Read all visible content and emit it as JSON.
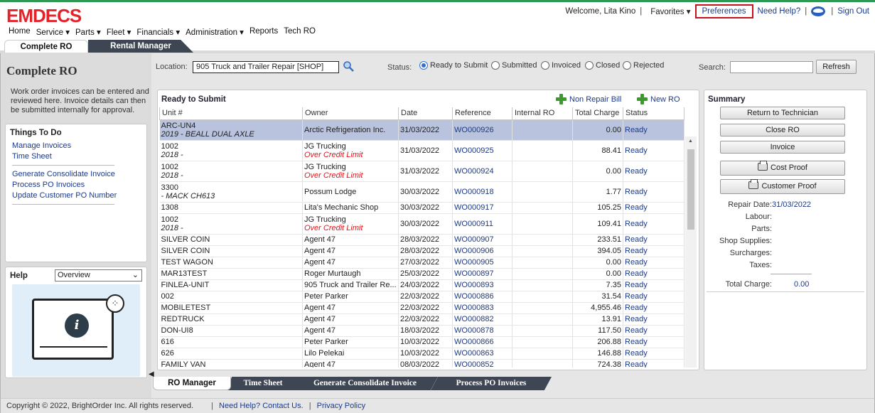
{
  "app": {
    "logo": "EMDECS"
  },
  "topbar": {
    "welcome": "Welcome, Lita Kino",
    "favorites": "Favorites ▾",
    "preferences": "Preferences",
    "need_help": "Need Help?",
    "sign_out": "Sign Out"
  },
  "nav": [
    {
      "label": "Home"
    },
    {
      "label": "Service ▾"
    },
    {
      "label": "Parts ▾"
    },
    {
      "label": "Fleet ▾"
    },
    {
      "label": "Financials ▾"
    },
    {
      "label": "Administration ▾"
    },
    {
      "label": "Reports"
    },
    {
      "label": "Tech RO"
    }
  ],
  "tabs": {
    "complete_ro": "Complete RO",
    "rental_manager": "Rental Manager"
  },
  "left": {
    "title": "Complete RO",
    "description": "Work order invoices can be entered and reviewed here. Invoice details can then be submitted internally for approval.",
    "things_title": "Things To Do",
    "links": [
      "Manage Invoices",
      "Time Sheet",
      "Generate Consolidate Invoice",
      "Process PO Invoices",
      "Update Customer PO Number"
    ],
    "help_label": "Help",
    "help_select": "Overview"
  },
  "filter": {
    "location_label": "Location:",
    "location_value": "905 Truck and Trailer Repair [SHOP]",
    "status_label": "Status:",
    "statuses": [
      "Ready to Submit",
      "Submitted",
      "Invoiced",
      "Closed",
      "Rejected"
    ],
    "selected_status": "Ready to Submit",
    "search_label": "Search:",
    "search_value": "",
    "refresh": "Refresh"
  },
  "grid": {
    "title": "Ready to Submit",
    "non_repair_bill": "Non Repair Bill",
    "new_ro": "New RO",
    "columns": [
      "Unit #",
      "Owner",
      "Date",
      "Reference",
      "Internal RO",
      "Total Charge",
      "Status"
    ],
    "rows": [
      {
        "unit": "ARC-UN4",
        "unit_sub": "2019 - BEALL DUAL AXLE",
        "owner": "Arctic Refrigeration Inc.",
        "owner_sub": "",
        "date": "31/03/2022",
        "ref": "WO000926",
        "internal": "",
        "total": "0.00",
        "status": "Ready",
        "selected": true
      },
      {
        "unit": "1002",
        "unit_sub": "2018 -",
        "owner": "JG Trucking",
        "owner_sub": "Over Credit Limit",
        "date": "31/03/2022",
        "ref": "WO000925",
        "internal": "",
        "total": "88.41",
        "status": "Ready"
      },
      {
        "unit": "1002",
        "unit_sub": "2018 -",
        "owner": "JG Trucking",
        "owner_sub": "Over Credit Limit",
        "date": "31/03/2022",
        "ref": "WO000924",
        "internal": "",
        "total": "0.00",
        "status": "Ready"
      },
      {
        "unit": "3300",
        "unit_sub": "- MACK CH613",
        "owner": "Possum Lodge",
        "owner_sub": "",
        "date": "30/03/2022",
        "ref": "WO000918",
        "internal": "",
        "total": "1.77",
        "status": "Ready"
      },
      {
        "unit": "1308",
        "unit_sub": "",
        "owner": "Lita's Mechanic Shop",
        "owner_sub": "",
        "date": "30/03/2022",
        "ref": "WO000917",
        "internal": "",
        "total": "105.25",
        "status": "Ready"
      },
      {
        "unit": "1002",
        "unit_sub": "2018 -",
        "owner": "JG Trucking",
        "owner_sub": "Over Credit Limit",
        "date": "30/03/2022",
        "ref": "WO000911",
        "internal": "",
        "total": "109.41",
        "status": "Ready"
      },
      {
        "unit": "SILVER COIN",
        "unit_sub": "",
        "owner": "Agent 47",
        "owner_sub": "",
        "date": "28/03/2022",
        "ref": "WO000907",
        "internal": "",
        "total": "233.51",
        "status": "Ready"
      },
      {
        "unit": "SILVER COIN",
        "unit_sub": "",
        "owner": "Agent 47",
        "owner_sub": "",
        "date": "28/03/2022",
        "ref": "WO000906",
        "internal": "",
        "total": "394.05",
        "status": "Ready"
      },
      {
        "unit": "TEST WAGON",
        "unit_sub": "",
        "owner": "Agent 47",
        "owner_sub": "",
        "date": "27/03/2022",
        "ref": "WO000905",
        "internal": "",
        "total": "0.00",
        "status": "Ready"
      },
      {
        "unit": "MAR13TEST",
        "unit_sub": "",
        "owner": "Roger Murtaugh",
        "owner_sub": "",
        "date": "25/03/2022",
        "ref": "WO000897",
        "internal": "",
        "total": "0.00",
        "status": "Ready"
      },
      {
        "unit": "FINLEA-UNIT",
        "unit_sub": "",
        "owner": "905 Truck and Trailer Re...",
        "owner_sub": "",
        "date": "24/03/2022",
        "ref": "WO000893",
        "internal": "",
        "total": "7.35",
        "status": "Ready"
      },
      {
        "unit": "002",
        "unit_sub": "",
        "owner": "Peter Parker",
        "owner_sub": "",
        "date": "22/03/2022",
        "ref": "WO000886",
        "internal": "",
        "total": "31.54",
        "status": "Ready"
      },
      {
        "unit": "MOBILETEST",
        "unit_sub": "",
        "owner": "Agent 47",
        "owner_sub": "",
        "date": "22/03/2022",
        "ref": "WO000883",
        "internal": "",
        "total": "4,955.46",
        "status": "Ready"
      },
      {
        "unit": "REDTRUCK",
        "unit_sub": "",
        "owner": "Agent 47",
        "owner_sub": "",
        "date": "22/03/2022",
        "ref": "WO000882",
        "internal": "",
        "total": "13.91",
        "status": "Ready"
      },
      {
        "unit": "DON-UI8",
        "unit_sub": "",
        "owner": "Agent 47",
        "owner_sub": "",
        "date": "18/03/2022",
        "ref": "WO000878",
        "internal": "",
        "total": "117.50",
        "status": "Ready"
      },
      {
        "unit": "616",
        "unit_sub": "",
        "owner": "Peter Parker",
        "owner_sub": "",
        "date": "10/03/2022",
        "ref": "WO000866",
        "internal": "",
        "total": "206.88",
        "status": "Ready"
      },
      {
        "unit": "626",
        "unit_sub": "",
        "owner": "Lilo Pelekai",
        "owner_sub": "",
        "date": "10/03/2022",
        "ref": "WO000863",
        "internal": "",
        "total": "146.88",
        "status": "Ready"
      },
      {
        "unit": "FAMILY VAN",
        "unit_sub": "",
        "owner": "Agent 47",
        "owner_sub": "",
        "date": "08/03/2022",
        "ref": "WO000852",
        "internal": "",
        "total": "724.38",
        "status": "Ready"
      }
    ]
  },
  "summary": {
    "title": "Summary",
    "buttons": [
      "Return to Technician",
      "Close RO",
      "Invoice",
      "Cost Proof",
      "Customer Proof"
    ],
    "repair_date_label": "Repair Date:",
    "repair_date": "31/03/2022",
    "labels": [
      "Labour:",
      "Parts:",
      "Shop Supplies:",
      "Surcharges:",
      "Taxes:"
    ],
    "total_label": "Total Charge:",
    "total_value": "0.00"
  },
  "bottom_tabs": [
    "RO Manager",
    "Time Sheet",
    "Generate Consolidate Invoice",
    "Process PO Invoices"
  ],
  "footer": {
    "copyright": "Copyright © 2022, BrightOrder Inc. All rights reserved.",
    "help_link": "Need Help? Contact Us.",
    "privacy": "Privacy Policy"
  },
  "colors": {
    "brand": "#e4222a",
    "link": "#1a3a8c",
    "dark_tab": "#3d4652",
    "warn": "#e0151b",
    "highlight": "#c7121d"
  },
  "icons": [
    "search-icon",
    "plus-icon",
    "printer-icon",
    "user-icon",
    "info-icon"
  ]
}
